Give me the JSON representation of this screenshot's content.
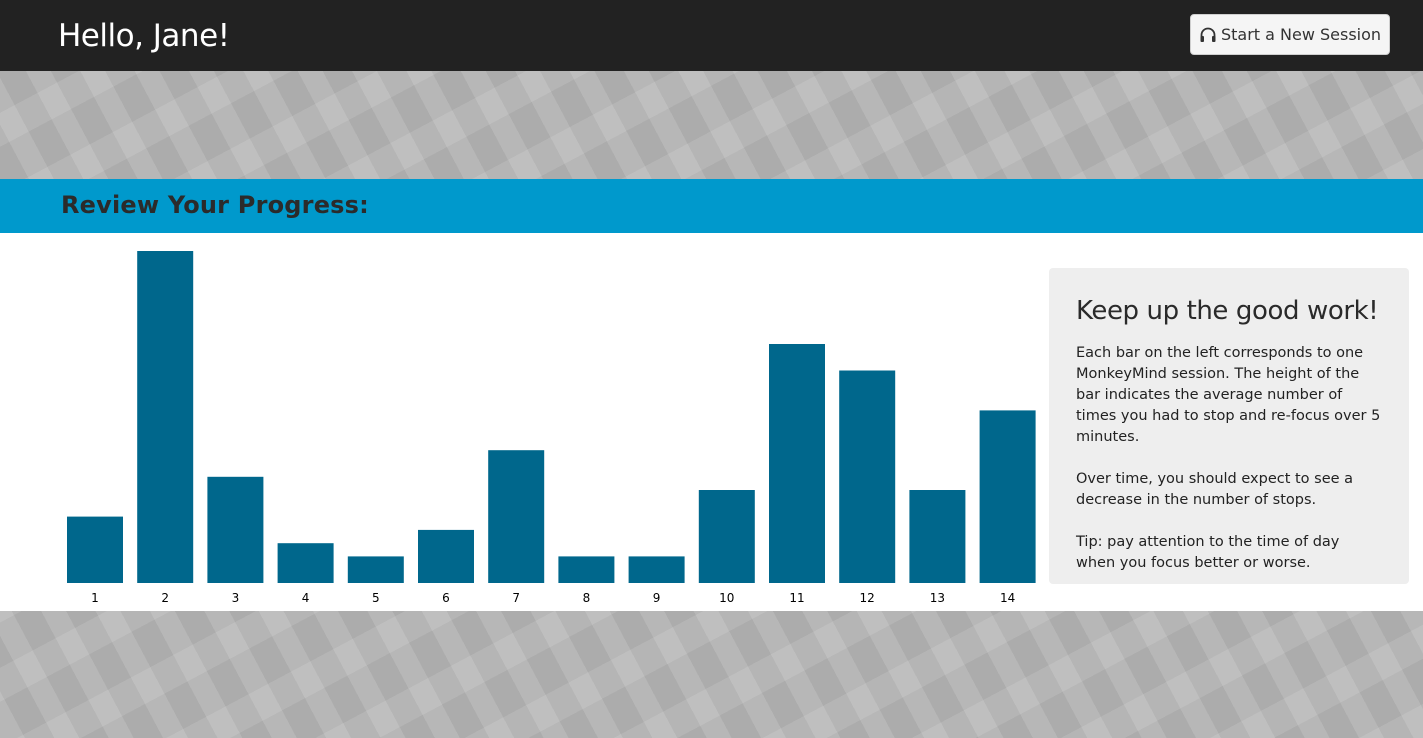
{
  "header": {
    "greeting": "Hello, Jane!",
    "session_button_label": "Start a New Session",
    "session_button_icon": "headphones-icon"
  },
  "section": {
    "title": "Review Your Progress:"
  },
  "info": {
    "title": "Keep up the good work!",
    "paragraphs": [
      "Each bar on the left corresponds to one MonkeyMind session. The height of the bar indicates the average number of times you had to stop and re-focus over 5 minutes.",
      "Over time, you should expect to see a decrease in the number of stops.",
      "Tip: pay attention to the time of day when you focus better or worse."
    ]
  },
  "colors": {
    "bar": "#00678c",
    "band": "#0099cc",
    "topbar": "#222222"
  },
  "chart_data": {
    "type": "bar",
    "categories": [
      "1",
      "2",
      "3",
      "4",
      "5",
      "6",
      "7",
      "8",
      "9",
      "10",
      "11",
      "12",
      "13",
      "14"
    ],
    "values": [
      5,
      25,
      8,
      3,
      2,
      4,
      10,
      2,
      2,
      7,
      18,
      16,
      7,
      13
    ],
    "ylim": [
      0,
      25
    ],
    "title": "",
    "xlabel": "",
    "ylabel": "",
    "grid": false
  }
}
